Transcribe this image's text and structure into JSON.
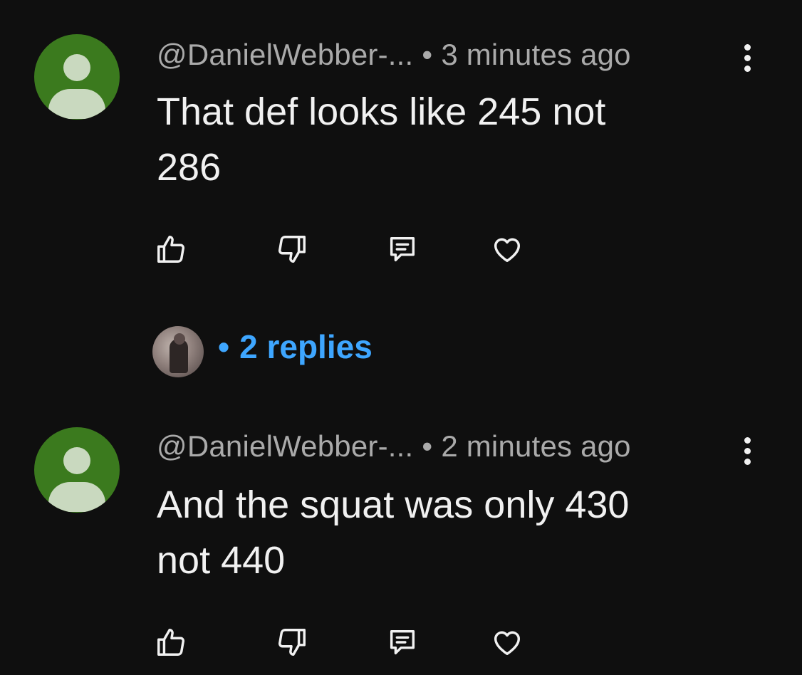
{
  "comments": [
    {
      "author": "@DanielWebber-...",
      "time": "3 minutes ago",
      "text": "That def looks like 245 not\n286"
    },
    {
      "author": "@DanielWebber-...",
      "time": "2 minutes ago",
      "text": "And the squat was only 430\nnot 440"
    }
  ],
  "separator": "•",
  "thread": {
    "replies_label": "2 replies"
  },
  "icons": {
    "like": "thumbs-up-icon",
    "dislike": "thumbs-down-icon",
    "reply": "comment-icon",
    "heart": "heart-icon",
    "menu": "more-vertical-icon"
  },
  "colors": {
    "background": "#0f0f0f",
    "avatar": "#3b7a1e",
    "meta_text": "#aaaaaa",
    "link": "#3ea6ff"
  }
}
